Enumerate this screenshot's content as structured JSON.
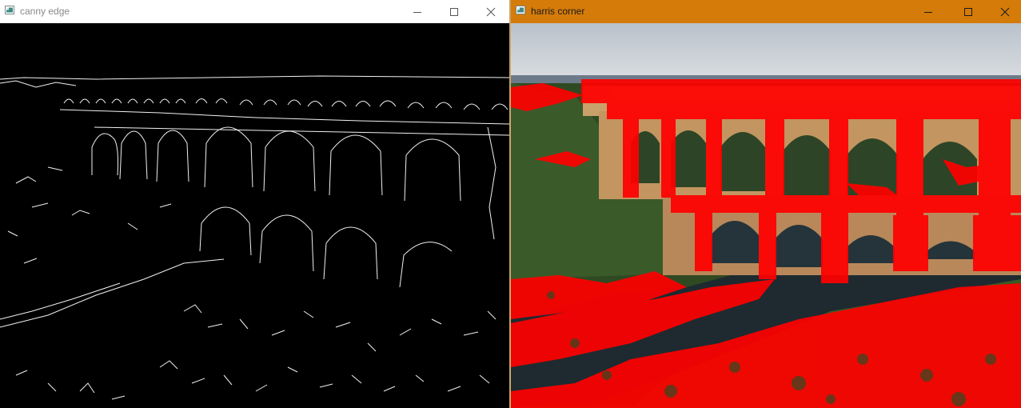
{
  "windows": {
    "left": {
      "title": "canny edge",
      "icons": {
        "app": "window-app-icon",
        "minimize": "minimize-icon",
        "maximize": "maximize-icon",
        "close": "close-icon"
      },
      "colors": {
        "titlebar": "#ffffff",
        "title_text": "#8a8a8a",
        "canvas": "#000000",
        "edges": "#ffffff"
      }
    },
    "right": {
      "title": "harris corner",
      "icons": {
        "app": "window-app-icon",
        "minimize": "minimize-icon",
        "maximize": "maximize-icon",
        "close": "close-icon"
      },
      "colors": {
        "titlebar": "#d47b0a",
        "title_text": "#1a1a1a",
        "corners": "#ff0000",
        "sky": "#c9cfd6",
        "foliage": "#2f4a22",
        "river": "#1e2a30",
        "stone": "#c9a16a"
      }
    }
  }
}
